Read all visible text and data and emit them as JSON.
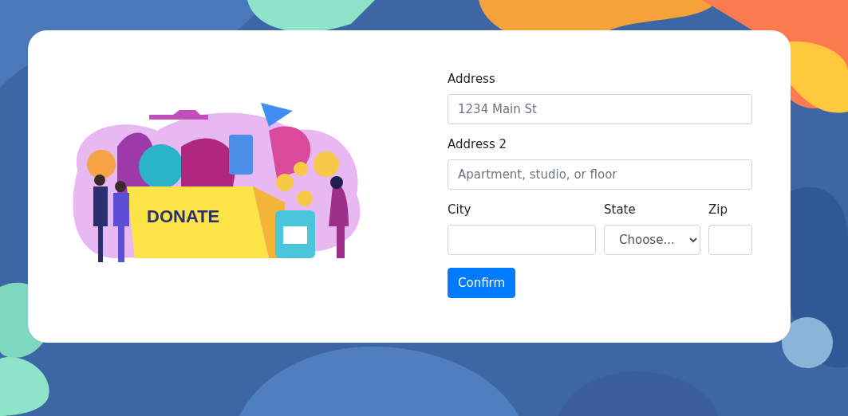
{
  "illustration": {
    "label": "DONATE"
  },
  "form": {
    "rows": [
      {
        "fields": [
          {
            "kind": "text",
            "label": "Address",
            "placeholder": "1234 Main St"
          }
        ]
      },
      {
        "fields": [
          {
            "kind": "text",
            "label": "Address 2",
            "placeholder": "Apartment, studio, or floor"
          }
        ]
      },
      {
        "fields": [
          {
            "kind": "text",
            "label": "City"
          },
          {
            "kind": "select",
            "label": "State",
            "value": "Choose..."
          },
          {
            "kind": "text",
            "label": "Zip"
          }
        ]
      }
    ],
    "submit": "Confirm"
  }
}
